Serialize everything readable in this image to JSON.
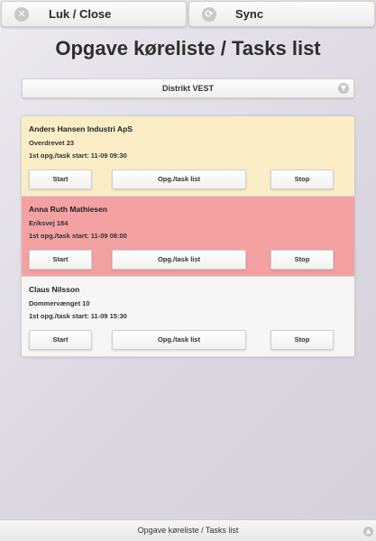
{
  "header": {
    "close_label": "Luk / Close",
    "close_icon": "close-icon",
    "sync_label": "Sync",
    "sync_icon": "refresh-icon"
  },
  "page": {
    "title": "Opgave køreliste / Tasks list"
  },
  "district_select": {
    "selected": "Distrikt VEST",
    "icon": "chevron-down-icon"
  },
  "tasks": [
    {
      "name": "Anders Hansen Industri ApS",
      "address": "Overdrevet 23",
      "start_text": "1st opg./task start: 11-09 09:30",
      "background": "#fbeec6",
      "start_label": "Start",
      "tasks_label": "Opg./task list",
      "stop_label": "Stop"
    },
    {
      "name": "Anna Ruth Mathiesen",
      "address": "Eriksvej 184",
      "start_text": "1st opg./task start: 11-09 08:00",
      "background": "#f4a1a3",
      "start_label": "Start",
      "tasks_label": "Opg./task list",
      "stop_label": "Stop"
    },
    {
      "name": "Claus Nilsson",
      "address": "Dommervænget 10",
      "start_text": "1st opg./task start: 11-09 15:30",
      "background": "#f6f6f6",
      "start_label": "Start",
      "tasks_label": "Opg./task list",
      "stop_label": "Stop"
    }
  ],
  "footer": {
    "text": "Opgave køreliste / Tasks list",
    "icon": "arrow-up-icon"
  }
}
